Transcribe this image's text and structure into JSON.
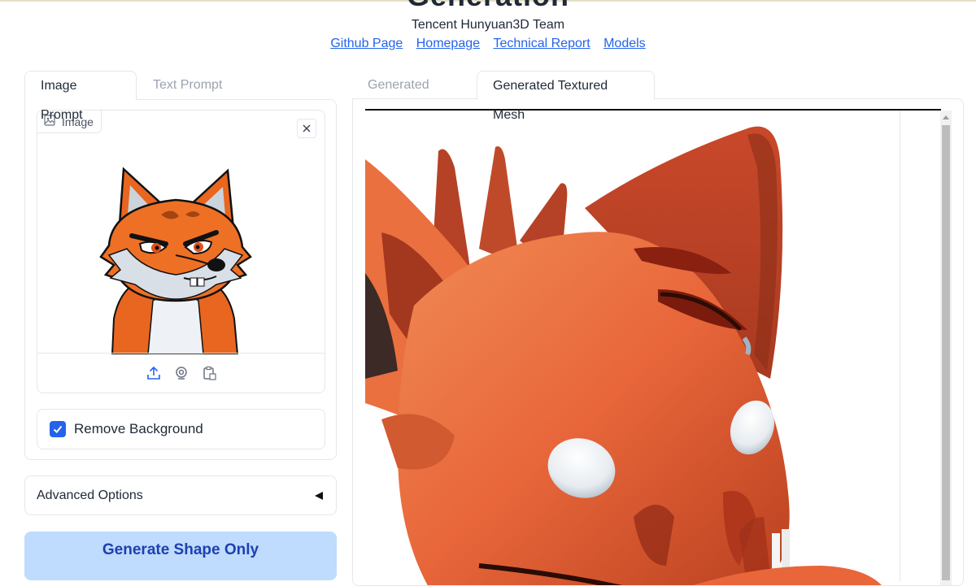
{
  "header": {
    "title": "Generation",
    "team": "Tencent Hunyuan3D Team",
    "links": [
      "Github Page",
      "Homepage",
      "Technical Report",
      "Models"
    ]
  },
  "left": {
    "tabs": [
      {
        "label": "Image Prompt",
        "active": true
      },
      {
        "label": "Text Prompt",
        "active": false
      }
    ],
    "image_label": "Image",
    "remove_background": {
      "label": "Remove Background",
      "checked": true
    },
    "advanced_label": "Advanced Options",
    "generate_label": "Generate Shape Only"
  },
  "right": {
    "tabs": [
      {
        "label": "Generated Mesh",
        "active": false
      },
      {
        "label": "Generated Textured Mesh",
        "active": true
      }
    ]
  },
  "colors": {
    "accent": "#2563eb",
    "button_bg": "#bfdbfe",
    "button_text": "#1e40af",
    "mesh_orange": "#e8663a"
  }
}
